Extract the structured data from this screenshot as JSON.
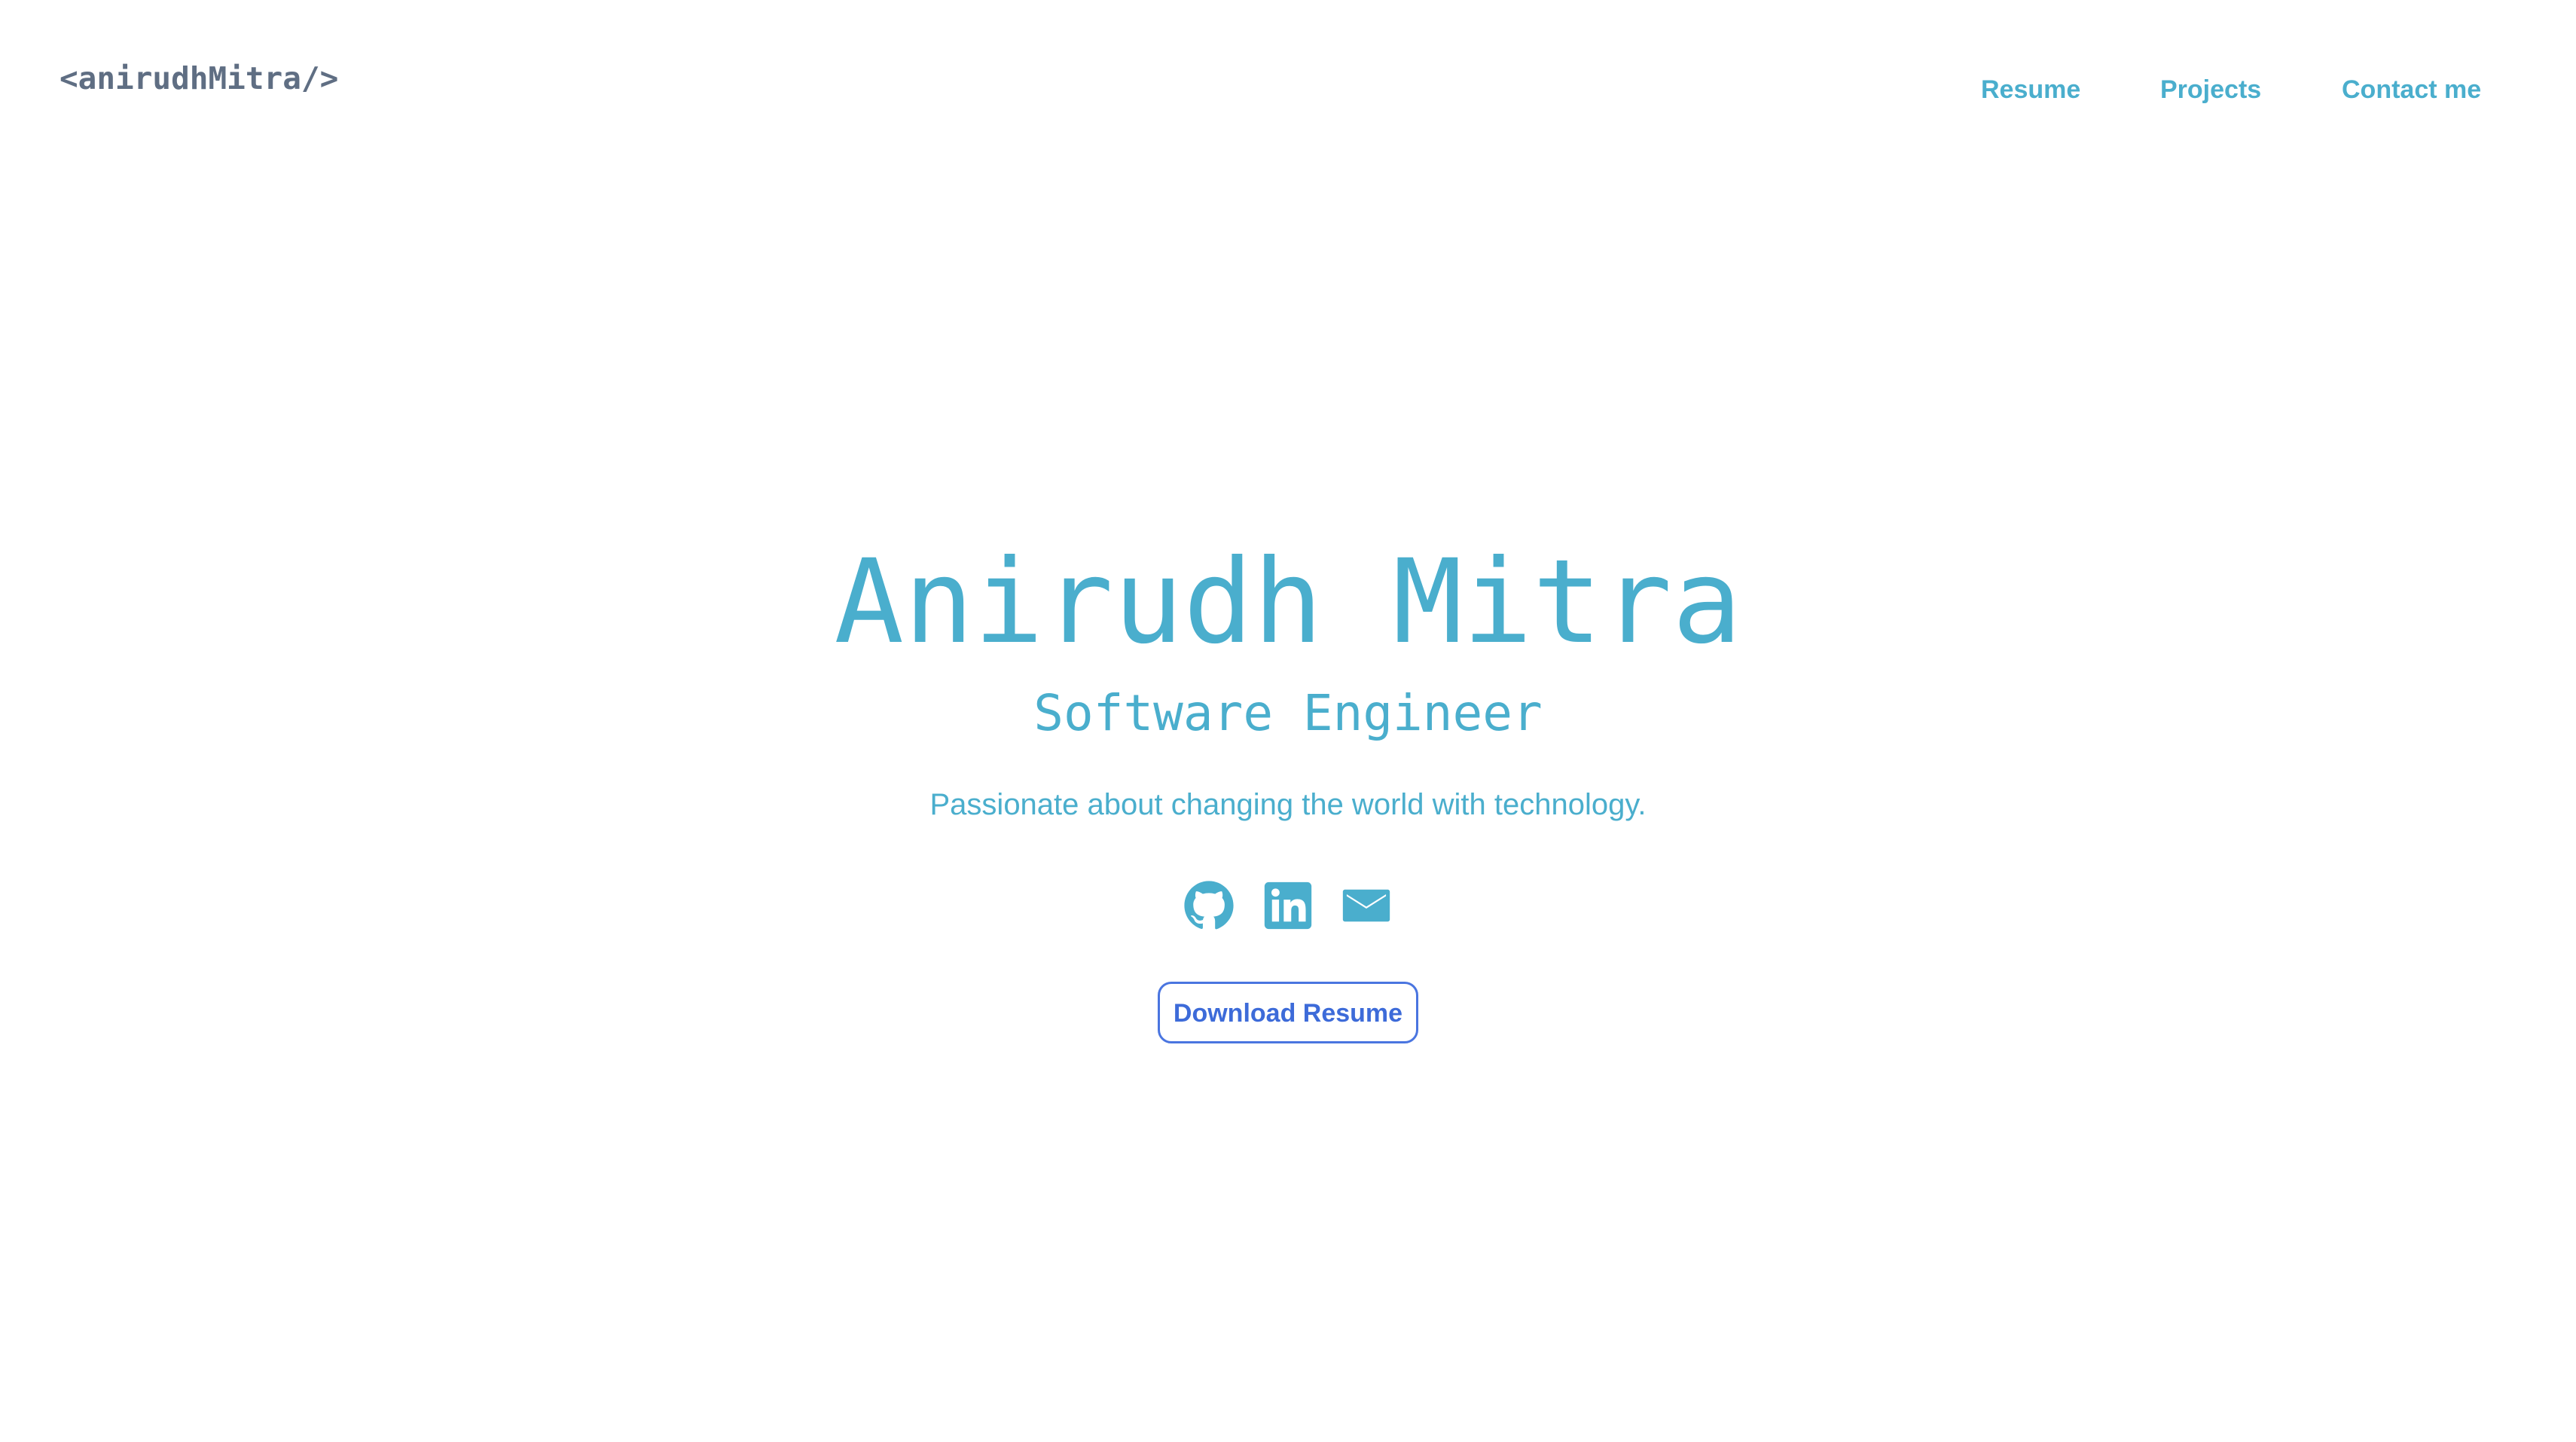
{
  "header": {
    "logo_text": "<anirudhMitra/>",
    "nav": [
      {
        "label": "Resume"
      },
      {
        "label": "Projects"
      },
      {
        "label": "Contact me"
      }
    ]
  },
  "hero": {
    "name": "Anirudh Mitra",
    "role": "Software Engineer",
    "tagline": "Passionate about changing the world with technology.",
    "socials": [
      {
        "icon": "github-icon"
      },
      {
        "icon": "linkedin-icon"
      },
      {
        "icon": "mail-icon"
      }
    ],
    "download_label": "Download Resume"
  },
  "colors": {
    "accent": "#4aaecd",
    "logo": "#5f6e83",
    "button": "#3d6bd9",
    "background": "#ffffff"
  }
}
